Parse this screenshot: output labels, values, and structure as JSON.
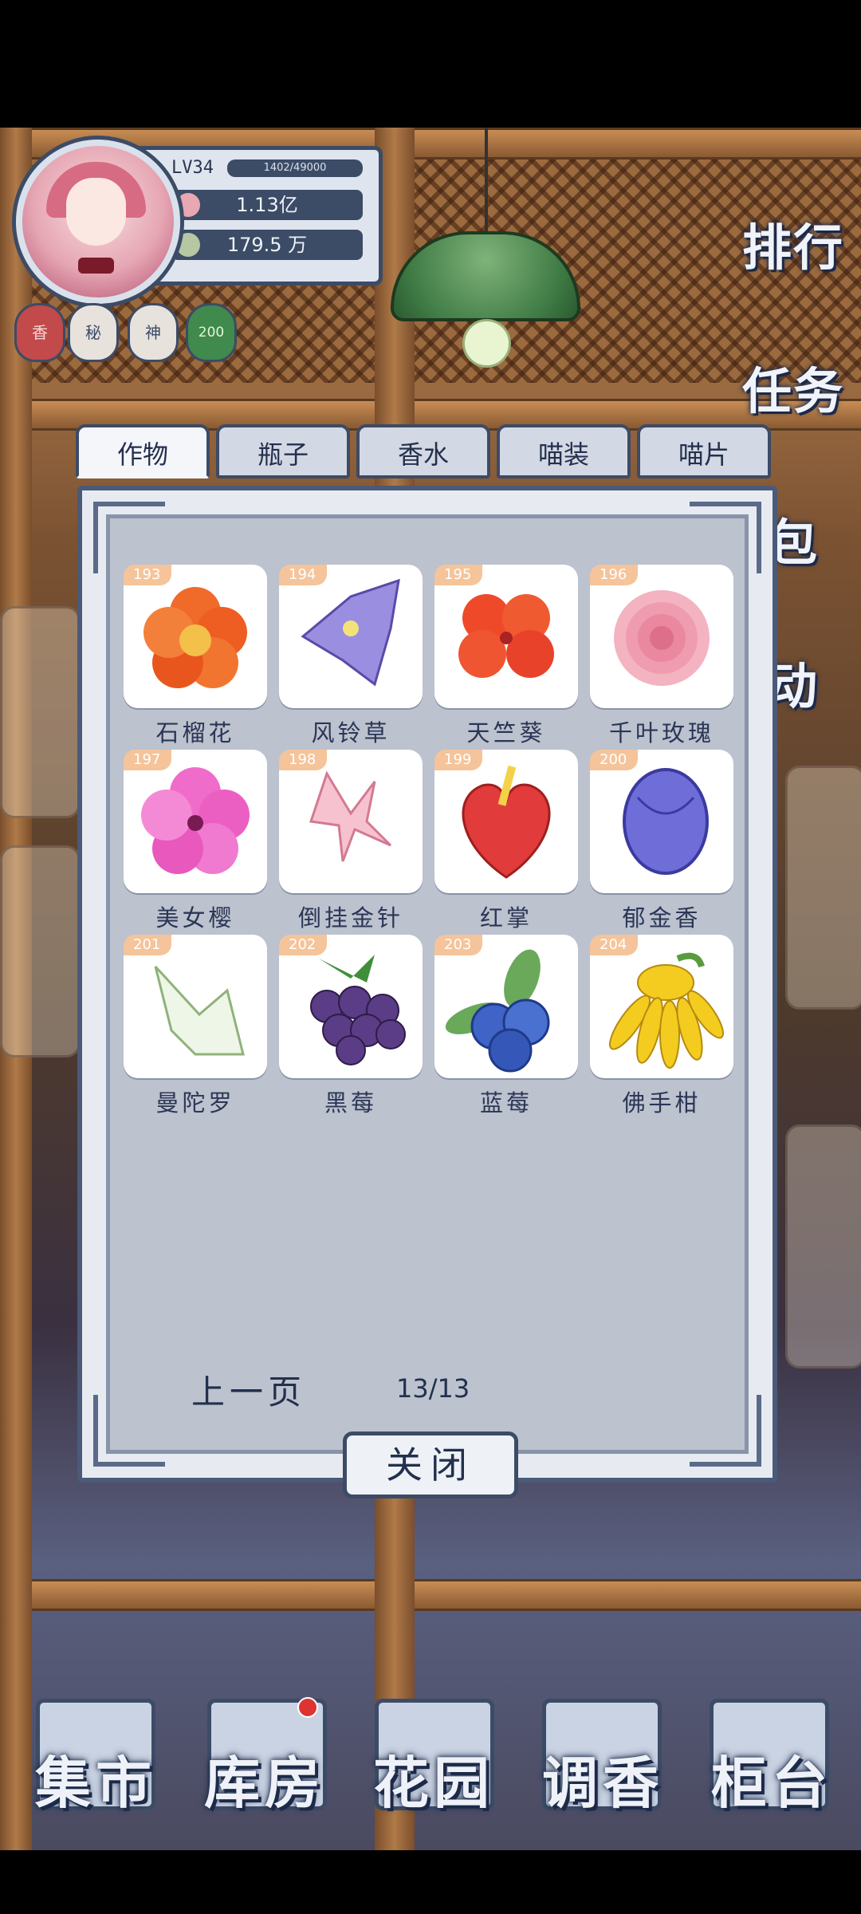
{
  "profile": {
    "level": "LV34",
    "exp": "1402/49000",
    "currency1": "1.13亿",
    "currency2": "179.5 万"
  },
  "badges": [
    "香",
    "秘",
    "神",
    "200"
  ],
  "side_buttons": [
    "排行",
    "任务",
    "包",
    "动"
  ],
  "tabs": [
    "作物",
    "瓶子",
    "香水",
    "喵装",
    "喵片"
  ],
  "items": [
    {
      "num": "193",
      "name": "石榴花"
    },
    {
      "num": "194",
      "name": "风铃草"
    },
    {
      "num": "195",
      "name": "天竺葵"
    },
    {
      "num": "196",
      "name": "千叶玫瑰"
    },
    {
      "num": "197",
      "name": "美女樱"
    },
    {
      "num": "198",
      "name": "倒挂金针"
    },
    {
      "num": "199",
      "name": "红掌"
    },
    {
      "num": "200",
      "name": "郁金香"
    },
    {
      "num": "201",
      "name": "曼陀罗"
    },
    {
      "num": "202",
      "name": "黑莓"
    },
    {
      "num": "203",
      "name": "蓝莓"
    },
    {
      "num": "204",
      "name": "佛手柑"
    }
  ],
  "pager": {
    "prev": "上一页",
    "page": "13/13"
  },
  "close": "关闭",
  "bottom_nav": [
    "集市",
    "库房",
    "花园",
    "调香",
    "柜台"
  ],
  "colors": {
    "frame": "#3c4b66",
    "panel": "#bcc2ce",
    "tag": "#f5c49a"
  }
}
